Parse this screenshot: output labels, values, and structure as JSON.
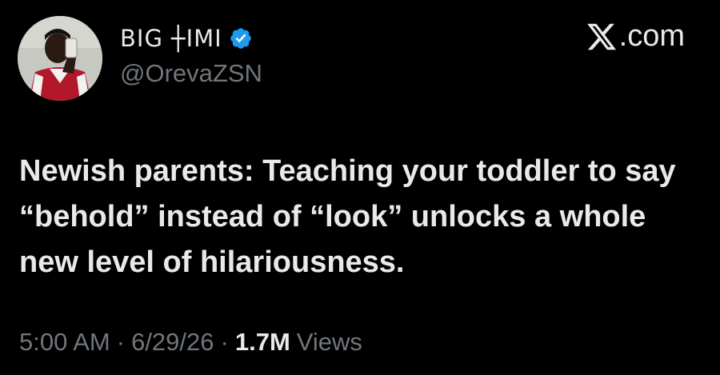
{
  "author": {
    "display_name": "BIG ┼IMI",
    "handle": "@OrevaZSN",
    "verified": true,
    "avatar_icon": "person-avatar"
  },
  "brand": {
    "logo_icon": "x-logo-icon",
    "site_text": ".com"
  },
  "tweet": {
    "text": "Newish parents: Teaching your toddler to say “behold” instead of “look” unlocks a whole new level of hilariousness."
  },
  "meta": {
    "time": "5:00 AM",
    "separator": "·",
    "date": "6/29/26",
    "views_count": "1.7M",
    "views_label": "Views"
  },
  "colors": {
    "background": "#000000",
    "primary_text": "#e7e9ea",
    "secondary_text": "#71767b",
    "verified_blue": "#1d9bf0"
  }
}
